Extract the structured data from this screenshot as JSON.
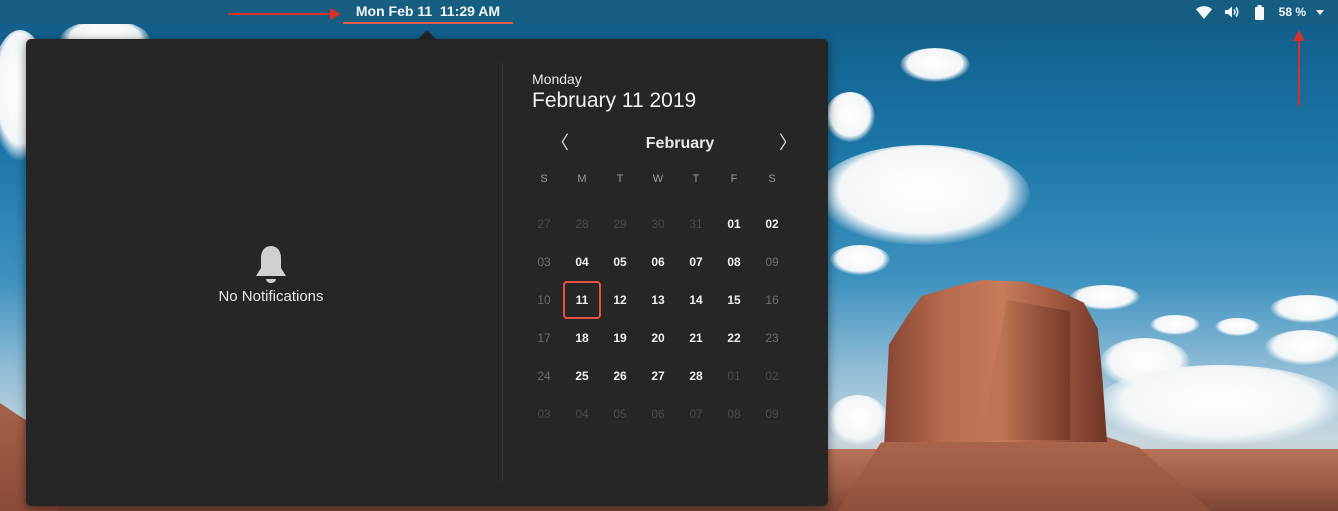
{
  "topbar": {
    "clock": "Mon Feb 11  11:29 AM",
    "battery_label": "58 %",
    "icons": [
      "wifi-icon",
      "volume-icon",
      "battery-icon",
      "system-menu-chevron-icon"
    ]
  },
  "notifications": {
    "empty_label": "No Notifications",
    "icon": "bell-icon"
  },
  "calendar": {
    "weekday": "Monday",
    "full_date": "February 11 2019",
    "month_label": "February",
    "prev_glyph": "〈",
    "next_glyph": "〉",
    "day_headers": [
      "S",
      "M",
      "T",
      "W",
      "T",
      "F",
      "S"
    ],
    "weeks": [
      [
        {
          "d": "27",
          "s": "out"
        },
        {
          "d": "28",
          "s": "out"
        },
        {
          "d": "29",
          "s": "out"
        },
        {
          "d": "30",
          "s": "out"
        },
        {
          "d": "31",
          "s": "out"
        },
        {
          "d": "01",
          "s": ""
        },
        {
          "d": "02",
          "s": ""
        }
      ],
      [
        {
          "d": "03",
          "s": "dim"
        },
        {
          "d": "04",
          "s": ""
        },
        {
          "d": "05",
          "s": ""
        },
        {
          "d": "06",
          "s": ""
        },
        {
          "d": "07",
          "s": ""
        },
        {
          "d": "08",
          "s": ""
        },
        {
          "d": "09",
          "s": "dim"
        }
      ],
      [
        {
          "d": "10",
          "s": "dim"
        },
        {
          "d": "11",
          "s": "today"
        },
        {
          "d": "12",
          "s": ""
        },
        {
          "d": "13",
          "s": ""
        },
        {
          "d": "14",
          "s": ""
        },
        {
          "d": "15",
          "s": ""
        },
        {
          "d": "16",
          "s": "dim"
        }
      ],
      [
        {
          "d": "17",
          "s": "dim"
        },
        {
          "d": "18",
          "s": ""
        },
        {
          "d": "19",
          "s": ""
        },
        {
          "d": "20",
          "s": ""
        },
        {
          "d": "21",
          "s": ""
        },
        {
          "d": "22",
          "s": ""
        },
        {
          "d": "23",
          "s": "dim"
        }
      ],
      [
        {
          "d": "24",
          "s": "dim"
        },
        {
          "d": "25",
          "s": ""
        },
        {
          "d": "26",
          "s": ""
        },
        {
          "d": "27",
          "s": ""
        },
        {
          "d": "28",
          "s": ""
        },
        {
          "d": "01",
          "s": "out"
        },
        {
          "d": "02",
          "s": "out"
        }
      ],
      [
        {
          "d": "03",
          "s": "out"
        },
        {
          "d": "04",
          "s": "out"
        },
        {
          "d": "05",
          "s": "out"
        },
        {
          "d": "06",
          "s": "out"
        },
        {
          "d": "07",
          "s": "out"
        },
        {
          "d": "08",
          "s": "out"
        },
        {
          "d": "09",
          "s": "out"
        }
      ]
    ]
  },
  "colors": {
    "topbar_bg": "#155e82",
    "popover_bg": "#262626",
    "today_outline": "#e4533f",
    "annotation_arrow": "#d6302a"
  }
}
